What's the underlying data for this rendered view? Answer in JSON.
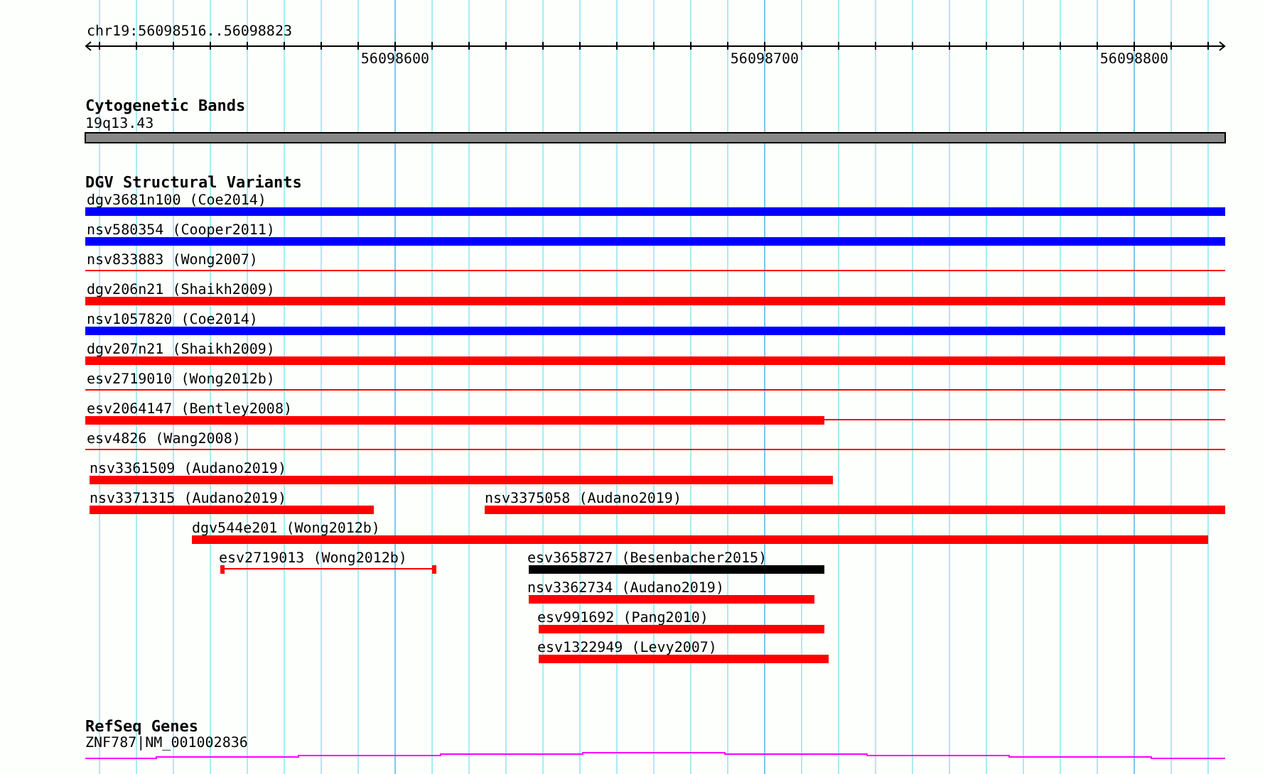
{
  "ruler": {
    "position": "chr19:56098516..56098823",
    "tick_labels": [
      "56098600",
      "56098700",
      "56098800"
    ]
  },
  "tracks": [
    {
      "kind": "ideogram",
      "title": "Cytogenetic Bands",
      "features": [
        {
          "label": "19q13.43",
          "color": "#888888"
        }
      ]
    },
    {
      "kind": "variants",
      "title": "DGV Structural Variants",
      "features": [
        {
          "label": "dgv3681n100 (Coe2014)",
          "kind": "block",
          "color": "#0000ff"
        },
        {
          "label": "nsv580354 (Cooper2011)",
          "kind": "block",
          "color": "#0000ff"
        },
        {
          "label": "nsv833883 (Wong2007)",
          "kind": "line",
          "color": "#ff0000"
        },
        {
          "label": "dgv206n21 (Shaikh2009)",
          "kind": "block",
          "color": "#ff0000"
        },
        {
          "label": "nsv1057820 (Coe2014)",
          "kind": "block",
          "color": "#0000ff"
        },
        {
          "label": "dgv207n21 (Shaikh2009)",
          "kind": "block",
          "color": "#ff0000"
        },
        {
          "label": "esv2719010 (Wong2012b)",
          "kind": "line",
          "color": "#ff0000"
        },
        {
          "label": "esv2064147 (Bentley2008)",
          "kind": "block-line",
          "color": "#ff0000"
        },
        {
          "label": "esv4826 (Wang2008)",
          "kind": "line",
          "color": "#ff0000"
        },
        {
          "label": "nsv3361509 (Audano2019)",
          "kind": "block",
          "color": "#ff0000"
        },
        {
          "label": "nsv3371315 (Audano2019)",
          "kind": "block",
          "color": "#ff0000"
        },
        {
          "label": "nsv3375058 (Audano2019)",
          "kind": "block",
          "color": "#ff0000"
        },
        {
          "label": "dgv544e201 (Wong2012b)",
          "kind": "block",
          "color": "#ff0000"
        },
        {
          "label": "esv2719013 (Wong2012b)",
          "kind": "capped-line",
          "color": "#ff0000"
        },
        {
          "label": "esv3658727 (Besenbacher2015)",
          "kind": "block",
          "color": "#000000"
        },
        {
          "label": "nsv3362734 (Audano2019)",
          "kind": "block",
          "color": "#ff0000"
        },
        {
          "label": "esv991692 (Pang2010)",
          "kind": "block",
          "color": "#ff0000"
        },
        {
          "label": "esv1322949 (Levy2007)",
          "kind": "block",
          "color": "#ff0000"
        }
      ]
    },
    {
      "kind": "genes",
      "title": "RefSeq Genes",
      "features": [
        {
          "label": "ZNF787|NM_001002836",
          "color": "#ff00ff"
        }
      ]
    }
  ]
}
